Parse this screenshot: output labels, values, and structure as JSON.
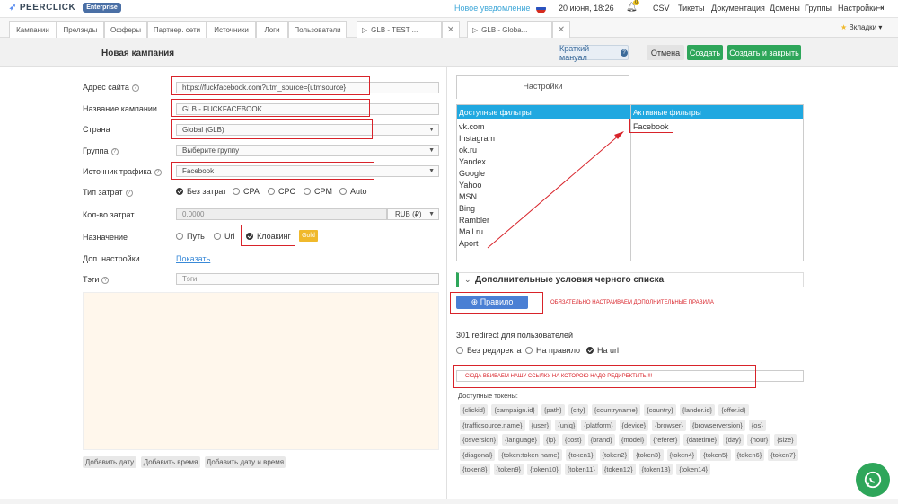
{
  "header": {
    "logo": "PEERCLICK",
    "edition": "Enterprise",
    "notification": "Новое уведомление",
    "datetime": "20 июня, 18:26",
    "bell_count": "0",
    "nav": [
      "CSV",
      "Тикеты",
      "Документация",
      "Домены",
      "Группы",
      "Настройки"
    ]
  },
  "tabs": {
    "items": [
      "Кампании",
      "Прелэнды",
      "Офферы",
      "Партнер. сети",
      "Источники",
      "Логи",
      "Пользователи"
    ],
    "open": [
      "GLB - TEST ...",
      "GLB - Globa..."
    ],
    "bookmarks": "Вкладки"
  },
  "page": {
    "title": "Новая кампания",
    "manual": "Краткий мануал",
    "cancel": "Отмена",
    "create": "Создать",
    "create_close": "Создать и закрыть"
  },
  "form": {
    "site_label": "Адрес сайта",
    "site_value": "https://fuckfacebook.com?utm_source={utmsource}",
    "name_label": "Название кампании",
    "name_value": "GLB - FUCKFACEBOOK",
    "country_label": "Страна",
    "country_value": "Global (GLB)",
    "group_label": "Группа",
    "group_value": "Выберите группу",
    "source_label": "Источник трафика",
    "source_value": "Facebook",
    "cost_type_label": "Тип затрат",
    "cost_types": [
      "Без затрат",
      "CPA",
      "CPC",
      "CPM",
      "Auto"
    ],
    "cost_amount_label": "Кол-во затрат",
    "cost_amount_value": "0.0000",
    "currency": "RUB (₽)",
    "purpose_label": "Назначение",
    "purposes": [
      "Путь",
      "Url",
      "Клоакинг"
    ],
    "gold": "Gold",
    "extra_label": "Доп. настройки",
    "extra_link": "Показать",
    "tags_label": "Тэги",
    "tags_placeholder": "Тэги",
    "date_buttons": [
      "Добавить дату",
      "Добавить время",
      "Добавить дату и время"
    ]
  },
  "filters": {
    "settings_tab": "Настройки",
    "available_title": "Доступные фильтры",
    "active_title": "Активные фильтры",
    "available": [
      "vk.com",
      "Instagram",
      "ok.ru",
      "Yandex",
      "Google",
      "Yahoo",
      "MSN",
      "Bing",
      "Rambler",
      "Mail.ru",
      "Aport"
    ],
    "active": [
      "Facebook"
    ]
  },
  "blacklist": {
    "title": "Дополнительные условия черного списка",
    "rule_button": "Правило",
    "rule_note": "ОБЯЗАТЕЛЬНО НАСТРАИВАЕМ ДОПОЛНИТЕЛЬНЫЕ ПРАВИЛА"
  },
  "redirect": {
    "label": "301 redirect для пользователей",
    "options": [
      "Без редиректа",
      "На правило",
      "На url"
    ],
    "note": "СЮДА ВБИВАЕМ НАШУ ССЫЛКУ НА КОТОРОЮ НАДО РЕДИРЕКТИТЬ !!!",
    "tokens_label": "Доступные токены:",
    "tokens": [
      "{clickid}",
      "{campaign.id}",
      "{path}",
      "{city}",
      "{countryname}",
      "{country}",
      "{lander.id}",
      "{offer.id}",
      "{trafficsource.name}",
      "{user}",
      "{uniq}",
      "{platform}",
      "{device}",
      "{browser}",
      "{browserversion}",
      "{os}",
      "{osversion}",
      "{language}",
      "{ip}",
      "{cost}",
      "{brand}",
      "{model}",
      "{referer}",
      "{datetime}",
      "{day}",
      "{hour}",
      "{size}",
      "{diagonal}",
      "{token:token name}",
      "{token1}",
      "{token2}",
      "{token3}",
      "{token4}",
      "{token5}",
      "{token6}",
      "{token7}",
      "{token8}",
      "{token9}",
      "{token10}",
      "{token11}",
      "{token12}",
      "{token13}",
      "{token14}"
    ]
  },
  "colors": {
    "accent": "#2ea65a",
    "filter_head": "#20a8e0",
    "annotation": "#d8232a"
  }
}
